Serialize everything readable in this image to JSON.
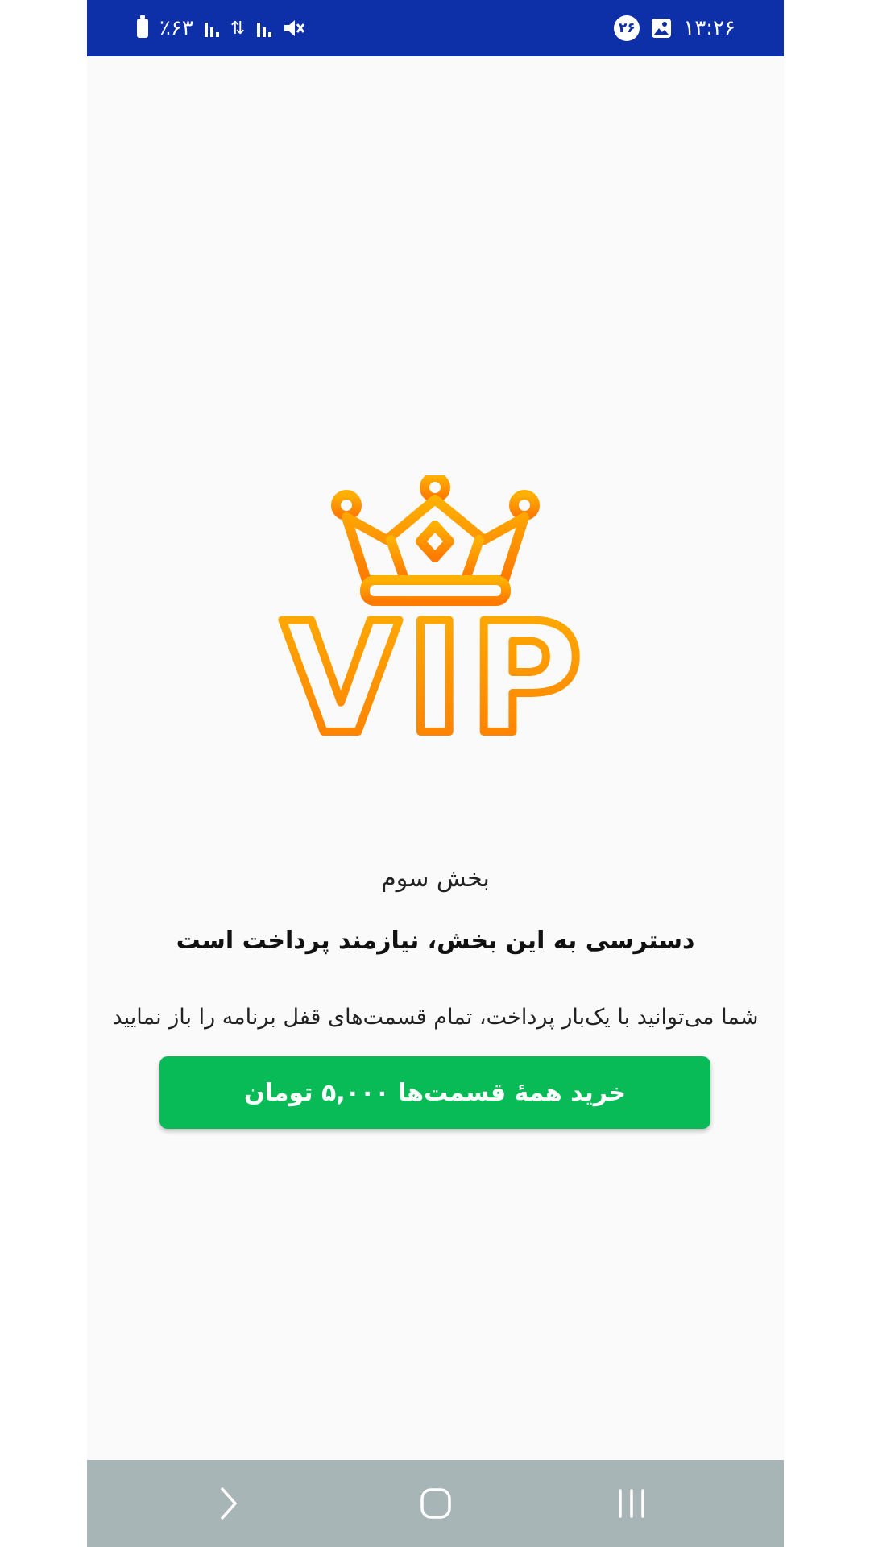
{
  "status_bar": {
    "time": "۱۳:۲۶",
    "notification_count": "۲۶",
    "battery": "٪۶۳",
    "icons": [
      "battery-icon",
      "signal-icon",
      "data-arrows-icon",
      "signal-icon",
      "mute-icon",
      "gallery-icon"
    ]
  },
  "main": {
    "logo_text": "VIP",
    "section_name": "بخش سوم",
    "headline": "دسترسی به این بخش، نیازمند پرداخت است",
    "description": "شما می‌توانید با یک‌بار پرداخت، تمام قسمت‌های قفل برنامه را باز نمایید",
    "buy_button_label": "خرید همهٔ قسمت‌ها ۵,۰۰۰ تومان"
  },
  "colors": {
    "status_bar": "#0d2fa8",
    "button": "#09bb56",
    "logo_top": "#ffb000",
    "logo_bottom": "#ff7a00",
    "nav_bar": "#a8b5b7"
  },
  "nav_bar": {
    "icons": [
      "back-icon",
      "home-icon",
      "recents-icon"
    ]
  }
}
